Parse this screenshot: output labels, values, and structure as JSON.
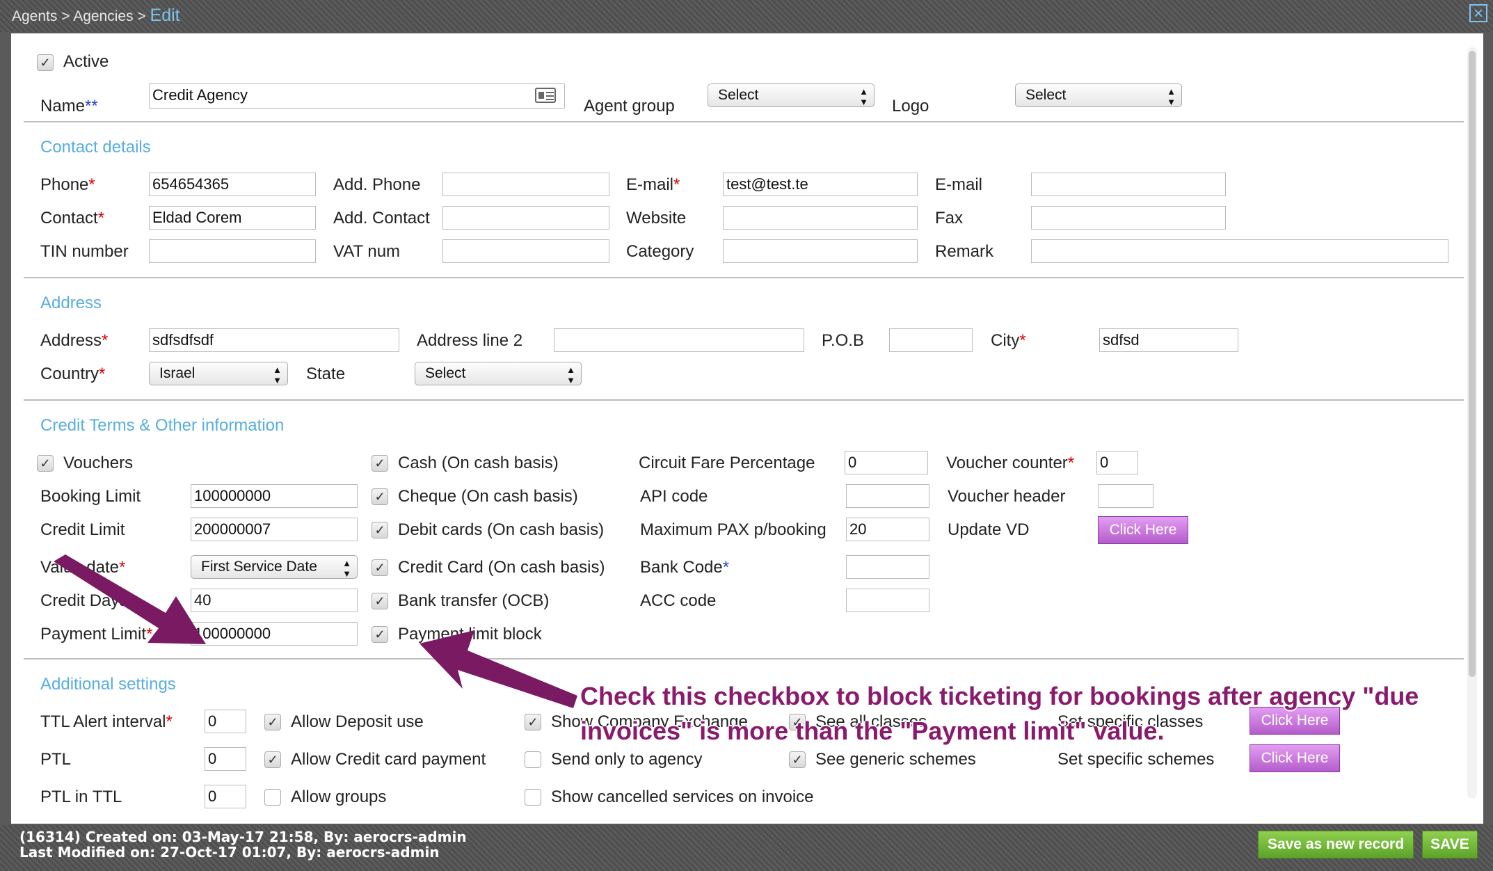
{
  "breadcrumb": {
    "part1": "Agents",
    "sep1": ">",
    "part2": "Agencies",
    "sep2": ">",
    "current": "Edit"
  },
  "header": {
    "active_label": "Active",
    "name_label": "Name",
    "name_req": "**",
    "name_value": "Credit Agency",
    "agent_group_label": "Agent group",
    "agent_group_value": "Select",
    "logo_label": "Logo",
    "logo_value": "Select"
  },
  "contact": {
    "title": "Contact details",
    "phone_label": "Phone",
    "phone_value": "654654365",
    "add_phone_label": "Add. Phone",
    "email_label": "E-mail",
    "email_value": "test@test.te",
    "email2_label": "E-mail",
    "contact_label": "Contact",
    "contact_value": "Eldad Corem",
    "add_contact_label": "Add. Contact",
    "website_label": "Website",
    "fax_label": "Fax",
    "tin_label": "TIN number",
    "vat_label": "VAT num",
    "category_label": "Category",
    "remark_label": "Remark"
  },
  "address": {
    "title": "Address",
    "address_label": "Address",
    "address_value": "sdfsdfsdf",
    "line2_label": "Address line 2",
    "pob_label": "P.O.B",
    "city_label": "City",
    "city_value": "sdfsd",
    "country_label": "Country",
    "country_value": "Israel",
    "state_label": "State",
    "state_value": "Select"
  },
  "credit": {
    "title": "Credit Terms & Other information",
    "vouchers_label": "Vouchers",
    "booking_limit_label": "Booking Limit",
    "booking_limit_value": "100000000",
    "credit_limit_label": "Credit Limit",
    "credit_limit_value": "200000007",
    "value_date_label": "Value date",
    "value_date_value": "First Service Date",
    "credit_days_label": "Credit Days",
    "credit_days_value": "40",
    "payment_limit_label": "Payment Limit",
    "payment_limit_value": "100000000",
    "cash_label": "Cash (On cash basis)",
    "cheque_label": "Cheque (On cash basis)",
    "debit_label": "Debit cards (On cash basis)",
    "credit_card_label": "Credit Card (On cash basis)",
    "bank_transfer_label": "Bank transfer (OCB)",
    "payment_block_label": "Payment limit block",
    "circuit_label": "Circuit Fare Percentage",
    "circuit_value": "0",
    "api_label": "API code",
    "max_pax_label": "Maximum PAX p/booking",
    "max_pax_value": "20",
    "bank_code_label": "Bank Code",
    "bank_code_req": "*",
    "acc_label": "ACC code",
    "voucher_counter_label": "Voucher counter",
    "voucher_counter_value": "0",
    "voucher_header_label": "Voucher header",
    "update_vd_label": "Update VD",
    "click_here": "Click Here"
  },
  "additional": {
    "title": "Additional settings",
    "ttl_label": "TTL Alert interval",
    "ttl_value": "0",
    "ptl_label": "PTL",
    "ptl_value": "0",
    "ptl_ttl_label": "PTL in TTL",
    "ptl_ttl_value": "0",
    "allow_deposit_label": "Allow Deposit use",
    "allow_cc_label": "Allow Credit card payment",
    "allow_groups_label": "Allow groups",
    "show_company_label": "Show Company Exchange",
    "send_only_label": "Send only to agency",
    "show_cancelled_label": "Show cancelled services on invoice",
    "see_all_label": "See all classes",
    "see_generic_label": "See generic schemes",
    "set_classes_label": "Set specific classes",
    "set_schemes_label": "Set specific schemes",
    "click_here": "Click Here"
  },
  "annotation": {
    "line1": "Check this checkbox to block ticketing for bookings after agency \"due",
    "line2": "invoices\" is more than the \"Payment limit\" value.",
    "color": "#8a1a6b"
  },
  "footer": {
    "created": "(16314) Created on: 03-May-17 21:58, By: aerocrs-admin",
    "modified": "Last Modified on: 27-Oct-17 01:07, By: aerocrs-admin",
    "save_new_label": "Save as new record",
    "save_label": "SAVE"
  },
  "colors": {
    "accent": "#56aee0",
    "required": "#dd0000",
    "button_purple": "#b55ccb",
    "button_green": "#5da32a"
  }
}
